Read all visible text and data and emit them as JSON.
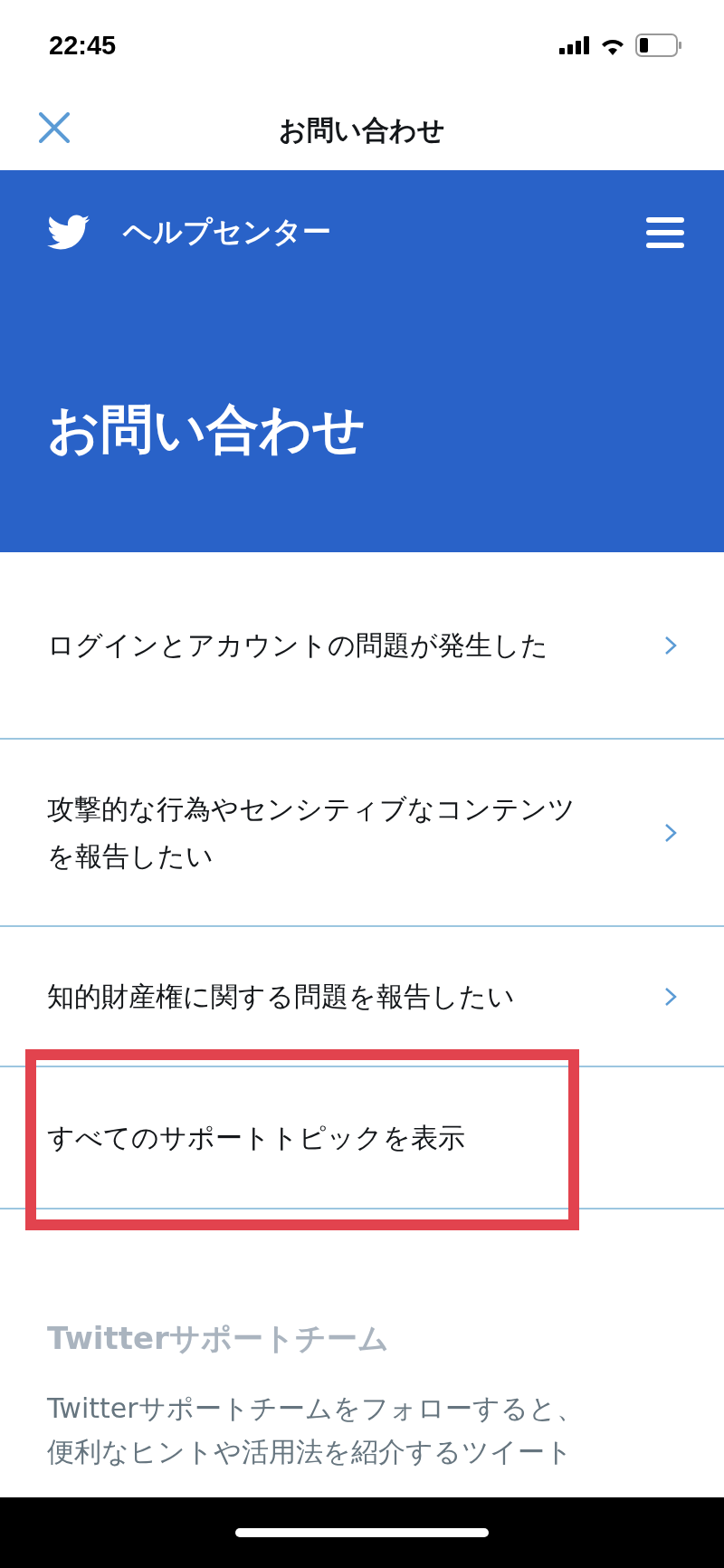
{
  "status_bar": {
    "time": "22:45"
  },
  "nav_bar": {
    "title": "お問い合わせ"
  },
  "header": {
    "site_name": "ヘルプセンター",
    "page_title": "お問い合わせ"
  },
  "items": [
    {
      "label": "ログインとアカウントの問題が発生した",
      "highlighted": false,
      "chevron": true
    },
    {
      "label": "攻撃的な行為やセンシティブなコンテンツを報告したい",
      "highlighted": false,
      "chevron": true
    },
    {
      "label": "知的財産権に関する問題を報告したい",
      "highlighted": false,
      "chevron": true
    },
    {
      "label": "すべてのサポートトピックを表示",
      "highlighted": true,
      "chevron": false
    }
  ],
  "section": {
    "heading": "Twitterサポートチーム",
    "body_lines": [
      "Twitterサポートチームをフォローすると、",
      "便利なヒントや活用法を紹介するツイート"
    ]
  }
}
